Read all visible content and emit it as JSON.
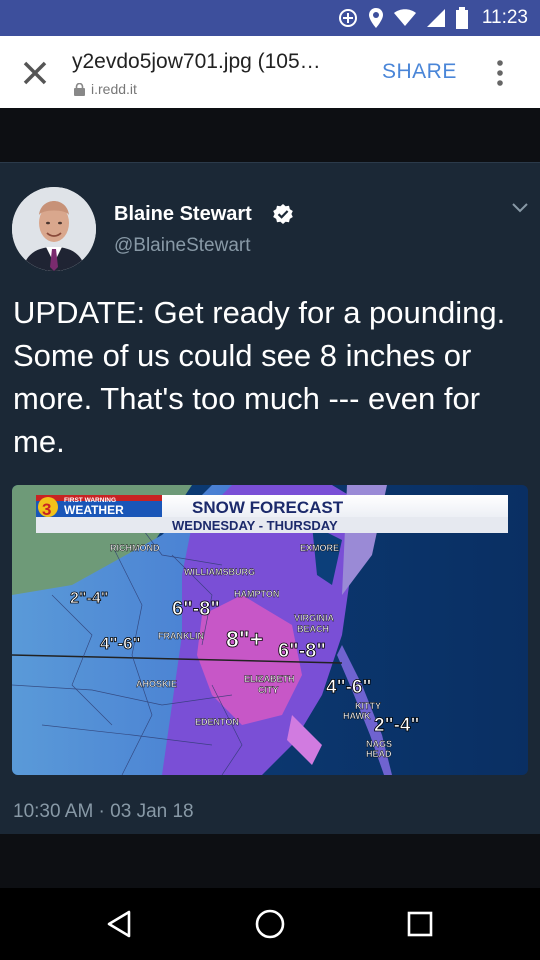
{
  "status_bar": {
    "time": "11:23"
  },
  "browser": {
    "title": "y2evdo5jow701.jpg (105…",
    "domain": "i.redd.it",
    "share_label": "SHARE"
  },
  "tweet": {
    "display_name": "Blaine Stewart",
    "handle": "@BlaineStewart",
    "text": "UPDATE: Get ready for a pounding. Some of us could see 8 inches or more. That's too much --- even for me.",
    "timestamp": "10:30 AM · 03 Jan 18"
  },
  "forecast_image": {
    "badge_number": "3",
    "badge_top": "FIRST WARNING",
    "badge_bottom": "WEATHER",
    "title": "SNOW FORECAST",
    "subtitle": "WEDNESDAY - THURSDAY",
    "places": {
      "richmond": "RICHMOND",
      "exmore": "EXMORE",
      "williamsburg": "WILLIAMSBURG",
      "hampton": "HAMPTON",
      "virginia": "VIRGINIA",
      "beach": "BEACH",
      "franklin": "FRANKLIN",
      "ahoskie": "AHOSKIE",
      "elizabeth": "ELIZABETH",
      "city": "CITY",
      "edenton": "EDENTON",
      "kitty": "KITTY",
      "hawk": "HAWK",
      "nags": "NAGS",
      "head": "HEAD"
    },
    "amounts": {
      "west": "2\"-4\"",
      "center": "6\"-8\"",
      "franklin": "4\"-6\"",
      "peak": "8\"+",
      "beach": "6\"-8\"",
      "kitty_hawk": "4\"-6\"",
      "outer_banks": "2\"-4\""
    }
  }
}
